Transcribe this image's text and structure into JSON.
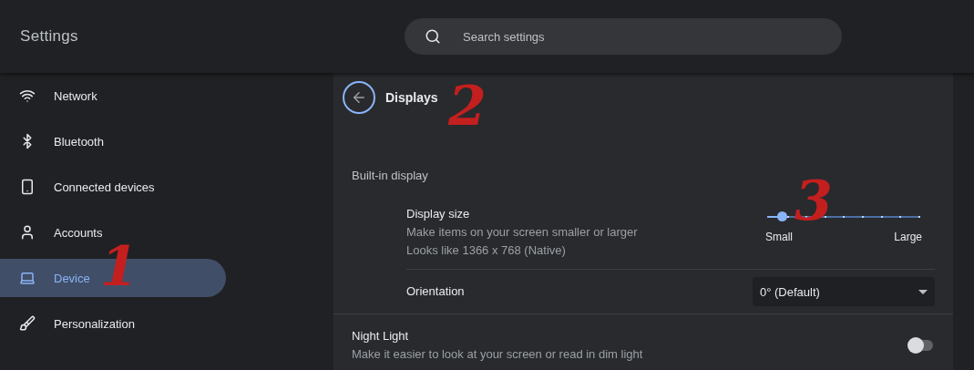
{
  "header": {
    "title": "Settings",
    "search": {
      "placeholder": "Search settings"
    }
  },
  "sidebar": {
    "items": [
      {
        "label": "Network",
        "selected": false
      },
      {
        "label": "Bluetooth",
        "selected": false
      },
      {
        "label": "Connected devices",
        "selected": false
      },
      {
        "label": "Accounts",
        "selected": false
      },
      {
        "label": "Device",
        "selected": true
      },
      {
        "label": "Personalization",
        "selected": false
      }
    ]
  },
  "page": {
    "title": "Displays",
    "section": "Built-in display",
    "display_size": {
      "title": "Display size",
      "lines": [
        "Make items on your screen smaller or larger",
        "Looks like 1366 x 768 (Native)"
      ],
      "level": 0.11,
      "min_label": "Small",
      "max_label": "Large"
    },
    "orientation": {
      "label": "Orientation",
      "value": "0° (Default)"
    },
    "night_light": {
      "title": "Night Light",
      "description": "Make it easier to look at your screen or read in dim light",
      "on": false
    }
  },
  "annotations": [
    "1",
    "2",
    "3"
  ]
}
